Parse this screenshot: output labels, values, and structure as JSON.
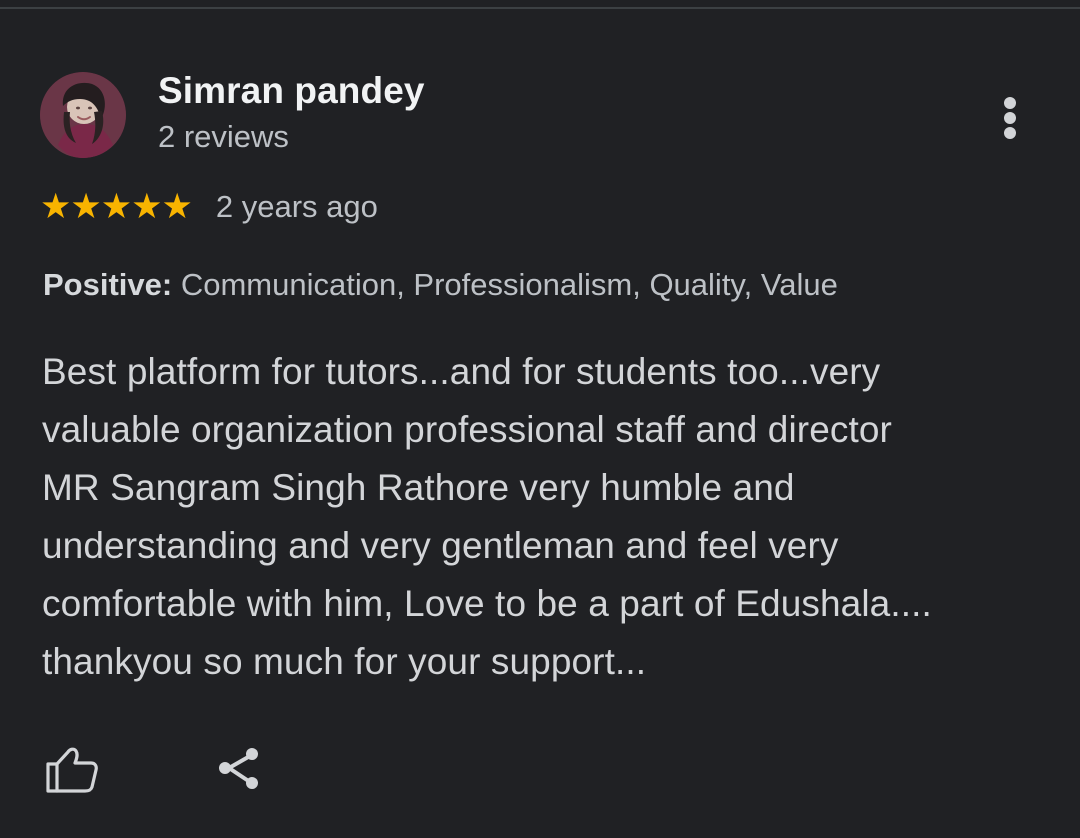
{
  "review": {
    "reviewer": {
      "name": "Simran pandey",
      "reviews": "2 reviews",
      "avatar": "profile-photo"
    },
    "rating": {
      "stars": "★★★★★",
      "value": 5,
      "max": 5,
      "star_color": "#f8b400"
    },
    "time": "2 years ago",
    "positive": {
      "label": "Positive:",
      "values": " Communication, Professionalism, Quality, Value"
    },
    "text_lines": [
      "Best platform for tutors...and for students too...very",
      "valuable organization professional staff and director",
      "MR Sangram Singh Rathore very humble and",
      "understanding and very gentleman and feel very",
      "comfortable with him, Love to be a part of Edushala....",
      "thankyou so much for your support..."
    ]
  },
  "icons": {
    "more": "more-vert-icon",
    "like": "thumbs-up-icon",
    "share": "share-icon"
  },
  "colors": {
    "background": "#202124",
    "primary_text": "#f1f3f4",
    "secondary_text": "#bdc1c6",
    "body_text": "#d3d5d8"
  }
}
